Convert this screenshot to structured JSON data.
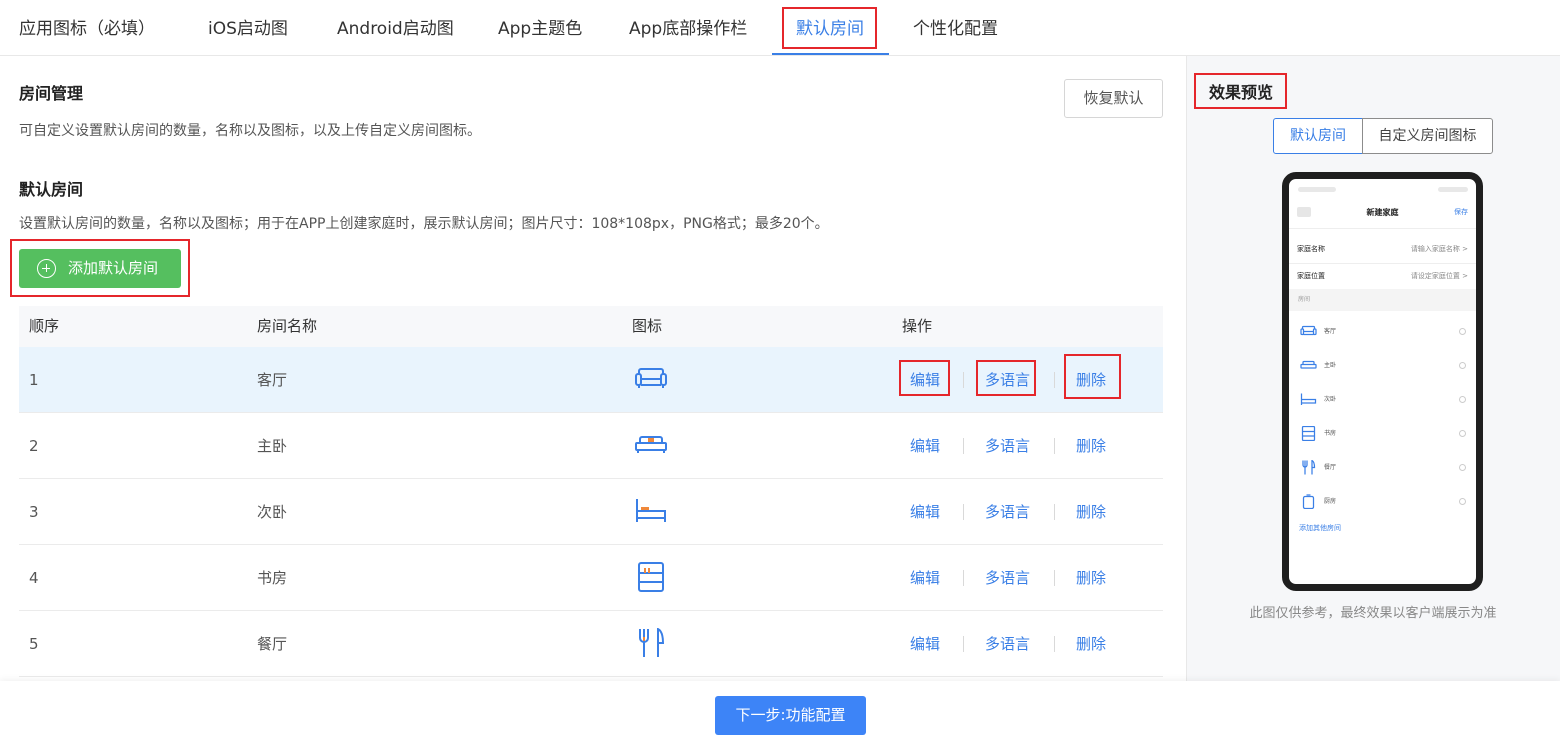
{
  "tabs": [
    {
      "label": "应用图标（必填）"
    },
    {
      "label": "iOS启动图"
    },
    {
      "label": "Android启动图"
    },
    {
      "label": "App主题色"
    },
    {
      "label": "App底部操作栏"
    },
    {
      "label": "默认房间"
    },
    {
      "label": "个性化配置"
    }
  ],
  "active_tab": "默认房间",
  "room_management": {
    "title": "房间管理",
    "description": "可自定义设置默认房间的数量，名称以及图标，以及上传自定义房间图标。",
    "reset_button": "恢复默认"
  },
  "default_rooms": {
    "title": "默认房间",
    "description": "设置默认房间的数量，名称以及图标；用于在APP上创建家庭时，展示默认房间；图片尺寸：108*108px，PNG格式；最多20个。",
    "add_button": "添加默认房间"
  },
  "table": {
    "headers": {
      "order": "顺序",
      "name": "房间名称",
      "icon": "图标",
      "actions": "操作"
    },
    "rows": [
      {
        "order": "1",
        "name": "客厅",
        "icon": "sofa-icon"
      },
      {
        "order": "2",
        "name": "主卧",
        "icon": "double-bed-icon"
      },
      {
        "order": "3",
        "name": "次卧",
        "icon": "single-bed-icon"
      },
      {
        "order": "4",
        "name": "书房",
        "icon": "bookshelf-icon"
      },
      {
        "order": "5",
        "name": "餐厅",
        "icon": "fork-knife-icon"
      }
    ],
    "actions": {
      "edit": "编辑",
      "i18n": "多语言",
      "delete": "删除"
    }
  },
  "next_button": "下一步:功能配置",
  "preview": {
    "title": "效果预览",
    "segments": [
      "默认房间",
      "自定义房间图标"
    ],
    "note": "此图仅供参考，最终效果以客户端展示为准",
    "phone": {
      "title": "新建家庭",
      "save": "保存",
      "home_name_label": "家庭名称",
      "home_name_placeholder": "请输入家庭名称",
      "home_location_label": "家庭位置",
      "home_location_placeholder": "请设定家庭位置",
      "rooms_header": "房间",
      "rooms": [
        "客厅",
        "主卧",
        "次卧",
        "书房",
        "餐厅",
        "厨房"
      ],
      "add_other": "添加其他房间"
    }
  },
  "colors": {
    "accent": "#3a7fe6",
    "add_green": "#55bf5f",
    "next_blue": "#3d84f7",
    "highlight_box": "#e5262b",
    "icon_orange": "#f0883a"
  }
}
